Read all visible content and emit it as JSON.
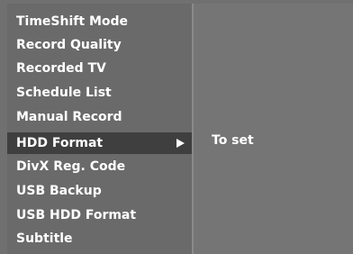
{
  "menu": {
    "items": [
      {
        "label": "TimeShift Mode"
      },
      {
        "label": "Record Quality"
      },
      {
        "label": "Recorded TV"
      },
      {
        "label": "Schedule List"
      },
      {
        "label": "Manual Record"
      },
      {
        "label": "HDD Format",
        "selected": true,
        "icon": "arrow-right-icon"
      },
      {
        "label": "DivX Reg. Code"
      },
      {
        "label": "USB Backup"
      },
      {
        "label": "USB HDD Format"
      },
      {
        "label": "Subtitle"
      }
    ]
  },
  "submenu": {
    "value": "To set"
  },
  "colors": {
    "background": "#707070",
    "selected_row": "#3f3f3f",
    "text": "#ffffff"
  }
}
